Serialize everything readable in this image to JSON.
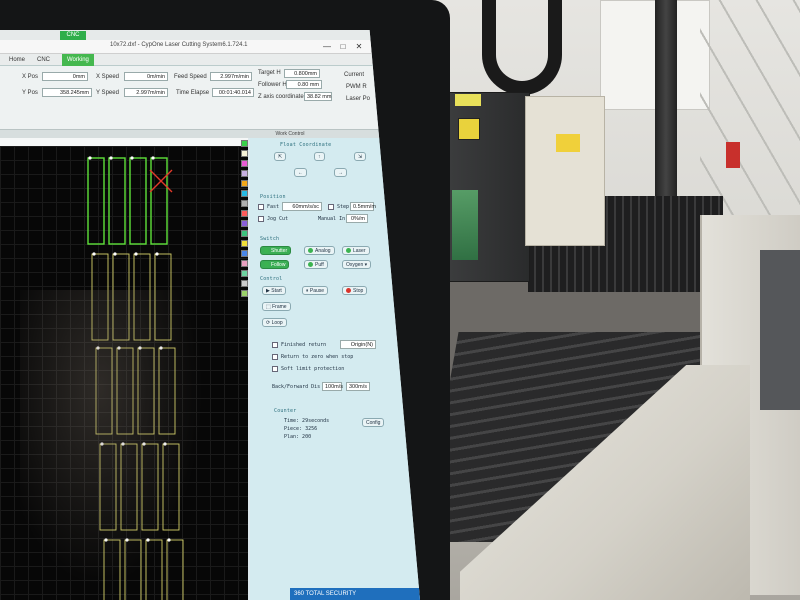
{
  "window": {
    "title": "10x72.dxf - CypOne Laser Cutting System6.1.724.1",
    "cnc_badge": "CNC",
    "minimize": "—",
    "maximize": "□",
    "close": "✕"
  },
  "tabs": [
    {
      "label": "Home"
    },
    {
      "label": "CNC"
    },
    {
      "label": "Working"
    }
  ],
  "status": {
    "x_pos_label": "X Pos",
    "x_pos_value": "0mm",
    "y_pos_label": "Y Pos",
    "y_pos_value": "358.245mm",
    "x_speed_label": "X Speed",
    "x_speed_value": "0m/min",
    "y_speed_label": "Y Speed",
    "y_speed_value": "2.997m/min",
    "feed_speed_label": "Feed Speed",
    "feed_speed_value": "2.997m/min",
    "time_elapse_label": "Time Elapse",
    "time_elapse_value": "00:01:40.014",
    "target_h_label": "Target H",
    "target_h_value": "0.800mm",
    "follower_h_label": "Follower H",
    "follower_h_value": "0.80 mm",
    "z_axis_label": "Z axis coordinate",
    "z_axis_value": "38.82 mm",
    "current_label": "Current",
    "pwm_label": "PWM R",
    "laser_label": "Laser Po"
  },
  "work_control_title": "Work Control",
  "panel": {
    "float_coord": "Float Coordinate",
    "position": "Position",
    "fast_label": "Fast",
    "fast_value": "60mm/s/sc",
    "step_label": "Step",
    "step_value": "0.5mm/m",
    "jog_cut_label": "Jog Cut",
    "manual_label": "Manual In",
    "manual_value": "0%/m",
    "laser_switch": "Switch",
    "shutter": "Shutter",
    "analog": "Analog",
    "laser": "Laser",
    "follow": "Follow",
    "puff": "Puff",
    "oxygen": "Oxygen",
    "control": "Control",
    "start": "Start",
    "pause": "Pause",
    "stop": "Stop",
    "frame": "Frame",
    "loop": "Loop",
    "finished_return": "Finished return",
    "finished_return_value": "Origin(N)",
    "return_zero": "Return to zero when stop",
    "soft_limit": "Soft limit protection",
    "back_forward_label": "Back/Forward Dis",
    "back_forward_value": "100m/s",
    "back_forward_value2": "300m/s",
    "counter_label": "Counter",
    "time_label": "Time: 29seconds",
    "piece_label": "Piece: 3256",
    "plan_label": "Plan: 200",
    "config_btn": "Config"
  },
  "brand_bar": "360 TOTAL SECURITY",
  "swatch_colors": [
    "#39d24a",
    "#f6f2d7",
    "#e95bd4",
    "#c8b0e0",
    "#f4a81a",
    "#27b9e3",
    "#b0b0b0",
    "#ff5c5c",
    "#8a5ed9",
    "#3cc27d",
    "#f1df3a",
    "#4a86e8",
    "#e8a0c0",
    "#6ed2a0",
    "#cccccc",
    "#9bd16a"
  ],
  "path_colors": {
    "done": "#5ee13a",
    "pending": "#d8d36a",
    "marker": "#e33a2a"
  }
}
